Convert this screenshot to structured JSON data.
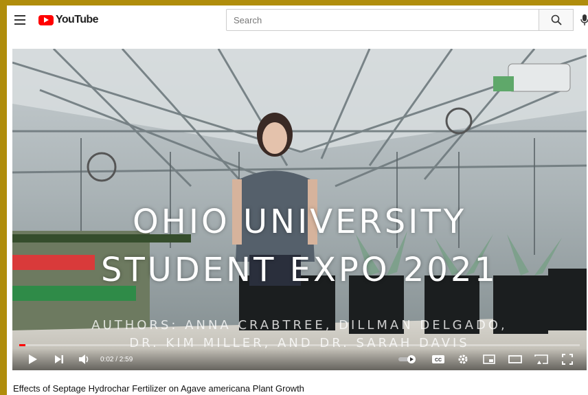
{
  "header": {
    "logo_text": "YouTube",
    "search_placeholder": "Search"
  },
  "video": {
    "overlay_line1": "OHIO UNIVERSITY",
    "overlay_line2": "STUDENT EXPO 2021",
    "authors_line1": "AUTHORS: ANNA CRABTREE, DILLMAN DELGADO,",
    "authors_line2": "DR. KIM MILLER, AND DR. SARAH DAVIS",
    "time": "0:02 / 2:59",
    "progress_fraction": 0.011
  },
  "title": "Effects of Septage Hydrochar Fertilizer on Agave americana Plant Growth",
  "icons": [
    "menu-icon",
    "youtube-logo",
    "search-icon",
    "mic-icon",
    "play-icon",
    "next-icon",
    "volume-icon",
    "autoplay-toggle",
    "cc-icon",
    "settings-icon",
    "miniplayer-icon",
    "theater-icon",
    "cast-icon",
    "fullscreen-icon"
  ],
  "colors": {
    "brand": "#ff0000",
    "border": "#b08d0c"
  }
}
